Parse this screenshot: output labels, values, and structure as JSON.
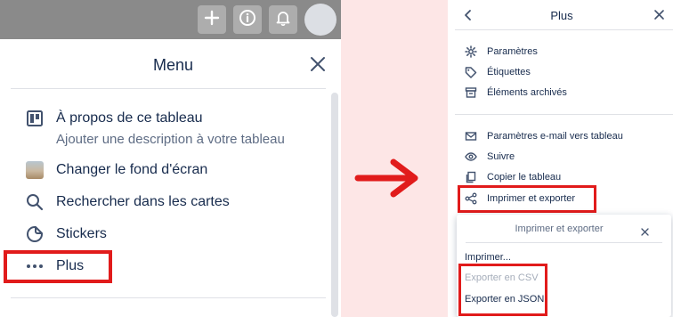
{
  "left_panel": {
    "menu_title": "Menu",
    "items": [
      {
        "label": "À propos de ce tableau",
        "sublabel": "Ajouter une description à votre tableau",
        "icon": "board-icon"
      },
      {
        "label": "Changer le fond d'écran",
        "icon": "background-thumbnail"
      },
      {
        "label": "Rechercher dans les cartes",
        "icon": "search-icon"
      },
      {
        "label": "Stickers",
        "icon": "sticker-icon"
      },
      {
        "label": "Plus",
        "icon": "more-icon"
      }
    ],
    "topbar_icons": [
      "plus-icon",
      "info-icon",
      "bell-icon",
      "avatar"
    ]
  },
  "right_panel": {
    "title": "Plus",
    "group1": [
      {
        "label": "Paramètres",
        "icon": "gear-icon"
      },
      {
        "label": "Étiquettes",
        "icon": "label-icon"
      },
      {
        "label": "Éléments archivés",
        "icon": "archive-icon"
      }
    ],
    "group2": [
      {
        "label": "Paramètres e-mail vers tableau",
        "icon": "email-icon"
      },
      {
        "label": "Suivre",
        "icon": "eye-icon"
      },
      {
        "label": "Copier le tableau",
        "icon": "copy-icon"
      },
      {
        "label": "Imprimer et exporter",
        "icon": "share-icon"
      }
    ]
  },
  "popover": {
    "title": "Imprimer et exporter",
    "items": [
      {
        "label": "Imprimer..."
      },
      {
        "label": "Exporter en CSV",
        "disabled": true
      },
      {
        "label": "Exporter en JSON"
      }
    ]
  },
  "colors": {
    "highlight": "#e11b1b",
    "background": "#fde6e6",
    "text": "#172b4d",
    "subtext": "#5e6c84"
  }
}
